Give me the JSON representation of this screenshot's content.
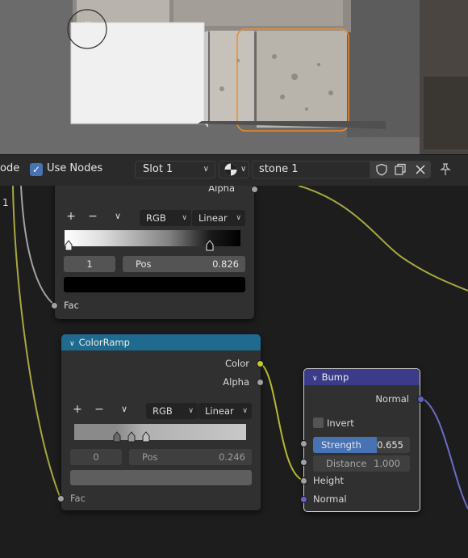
{
  "header": {
    "mode_label_partial": "ode",
    "use_nodes_label": "Use Nodes",
    "use_nodes_checked": true,
    "slot_label": "Slot 1",
    "material_name": "stone 1"
  },
  "upper_ramp": {
    "alpha_label": "Alpha",
    "add_label": "+",
    "remove_label": "−",
    "color_mode": "RGB",
    "interpolation": "Linear",
    "stop_index": "1",
    "pos_label": "Pos",
    "pos_value": "0.826",
    "fac_label": "Fac"
  },
  "color_ramp": {
    "title": "ColorRamp",
    "color_label": "Color",
    "alpha_label": "Alpha",
    "add_label": "+",
    "remove_label": "−",
    "color_mode": "RGB",
    "interpolation": "Linear",
    "stop_index": "0",
    "pos_label": "Pos",
    "pos_value": "0.246",
    "fac_label": "Fac"
  },
  "bump": {
    "title": "Bump",
    "normal_out_label": "Normal",
    "invert_label": "Invert",
    "strength_label": "Strength",
    "strength_value": "0.655",
    "strength_fraction": 0.655,
    "distance_label": "Distance",
    "distance_value": "1.000",
    "height_label": "Height",
    "normal_in_label": "Normal"
  },
  "edge_label": "1",
  "colors": {
    "colorramp_header": "#1f6a8f",
    "bump_header": "#3b3b8a",
    "socket_yellow": "#c7c729",
    "socket_gray": "#a1a1a1",
    "socket_purple": "#6363c7",
    "selection_outline": "#f08a24",
    "checkbox_blue": "#4772b3",
    "strength_fill": "#4772b3"
  }
}
